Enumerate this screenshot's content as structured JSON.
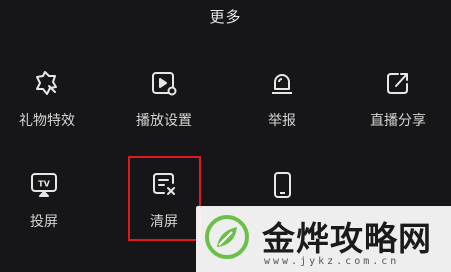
{
  "panel": {
    "title": "更多"
  },
  "items": [
    {
      "label": "礼物特效",
      "icon": "gift-effect-icon"
    },
    {
      "label": "播放设置",
      "icon": "playback-settings-icon"
    },
    {
      "label": "举报",
      "icon": "report-alarm-icon"
    },
    {
      "label": "直播分享",
      "icon": "share-icon"
    },
    {
      "label": "投屏",
      "icon": "cast-tv-icon"
    },
    {
      "label": "清屏",
      "icon": "clear-screen-icon"
    },
    {
      "label": "",
      "icon": "phone-icon"
    }
  ],
  "watermark": {
    "name": "金烨攻略网",
    "url": "www.jykz.com.cn"
  },
  "colors": {
    "background": "#161618",
    "text": "#d4d4d4",
    "highlight": "#e0191e",
    "logo_green": "#6cc04a"
  }
}
